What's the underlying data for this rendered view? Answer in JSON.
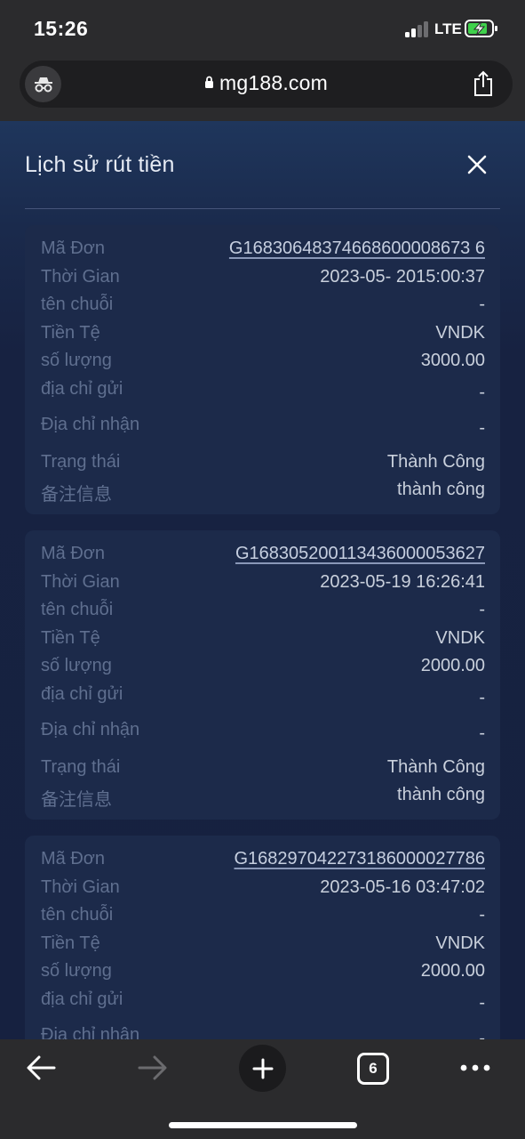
{
  "status_bar": {
    "time": "15:26",
    "network": "LTE"
  },
  "browser": {
    "url": "mg188.com",
    "tab_count": "6",
    "icons": {
      "left": "incognito-icon",
      "lock": "lock-icon",
      "share": "share-icon",
      "back": "back-arrow-icon",
      "forward": "forward-arrow-icon",
      "new_tab": "plus-icon",
      "tabs": "tabs-icon",
      "more": "more-dots-icon"
    }
  },
  "modal": {
    "title": "Lịch sử rút tiền",
    "close_icon": "close-icon"
  },
  "labels": {
    "order_id": "Mã Đơn",
    "time": "Thời Gian",
    "chain_name": "tên chuỗi",
    "currency": "Tiền Tệ",
    "amount": "số lượng",
    "send_address": "địa chỉ gửi",
    "receive_address": "Địa chỉ nhận",
    "status": "Trạng thái",
    "remark": "备注信息"
  },
  "records": [
    {
      "order_id": "G16830648374668600008673 6",
      "time": "2023-05- 2015:00:37",
      "chain_name": "-",
      "currency": "VNDK",
      "amount": "3000.00",
      "send_address": "-",
      "receive_address": "-",
      "status": "Thành Công",
      "remark": "thành công"
    },
    {
      "order_id": "G168305200113436000053627",
      "time": "2023-05-19 16:26:41",
      "chain_name": "-",
      "currency": "VNDK",
      "amount": "2000.00",
      "send_address": "-",
      "receive_address": "-",
      "status": "Thành Công",
      "remark": "thành công"
    },
    {
      "order_id": "G168297042273186000027786",
      "time": "2023-05-16 03:47:02",
      "chain_name": "-",
      "currency": "VNDK",
      "amount": "2000.00",
      "send_address": "-",
      "receive_address": "-",
      "status": "",
      "remark": ""
    }
  ],
  "colors": {
    "page_bg": "#162140",
    "card_bg": "#1c2a4a",
    "label": "#5f6f8f",
    "value": "#c9d0dc"
  }
}
